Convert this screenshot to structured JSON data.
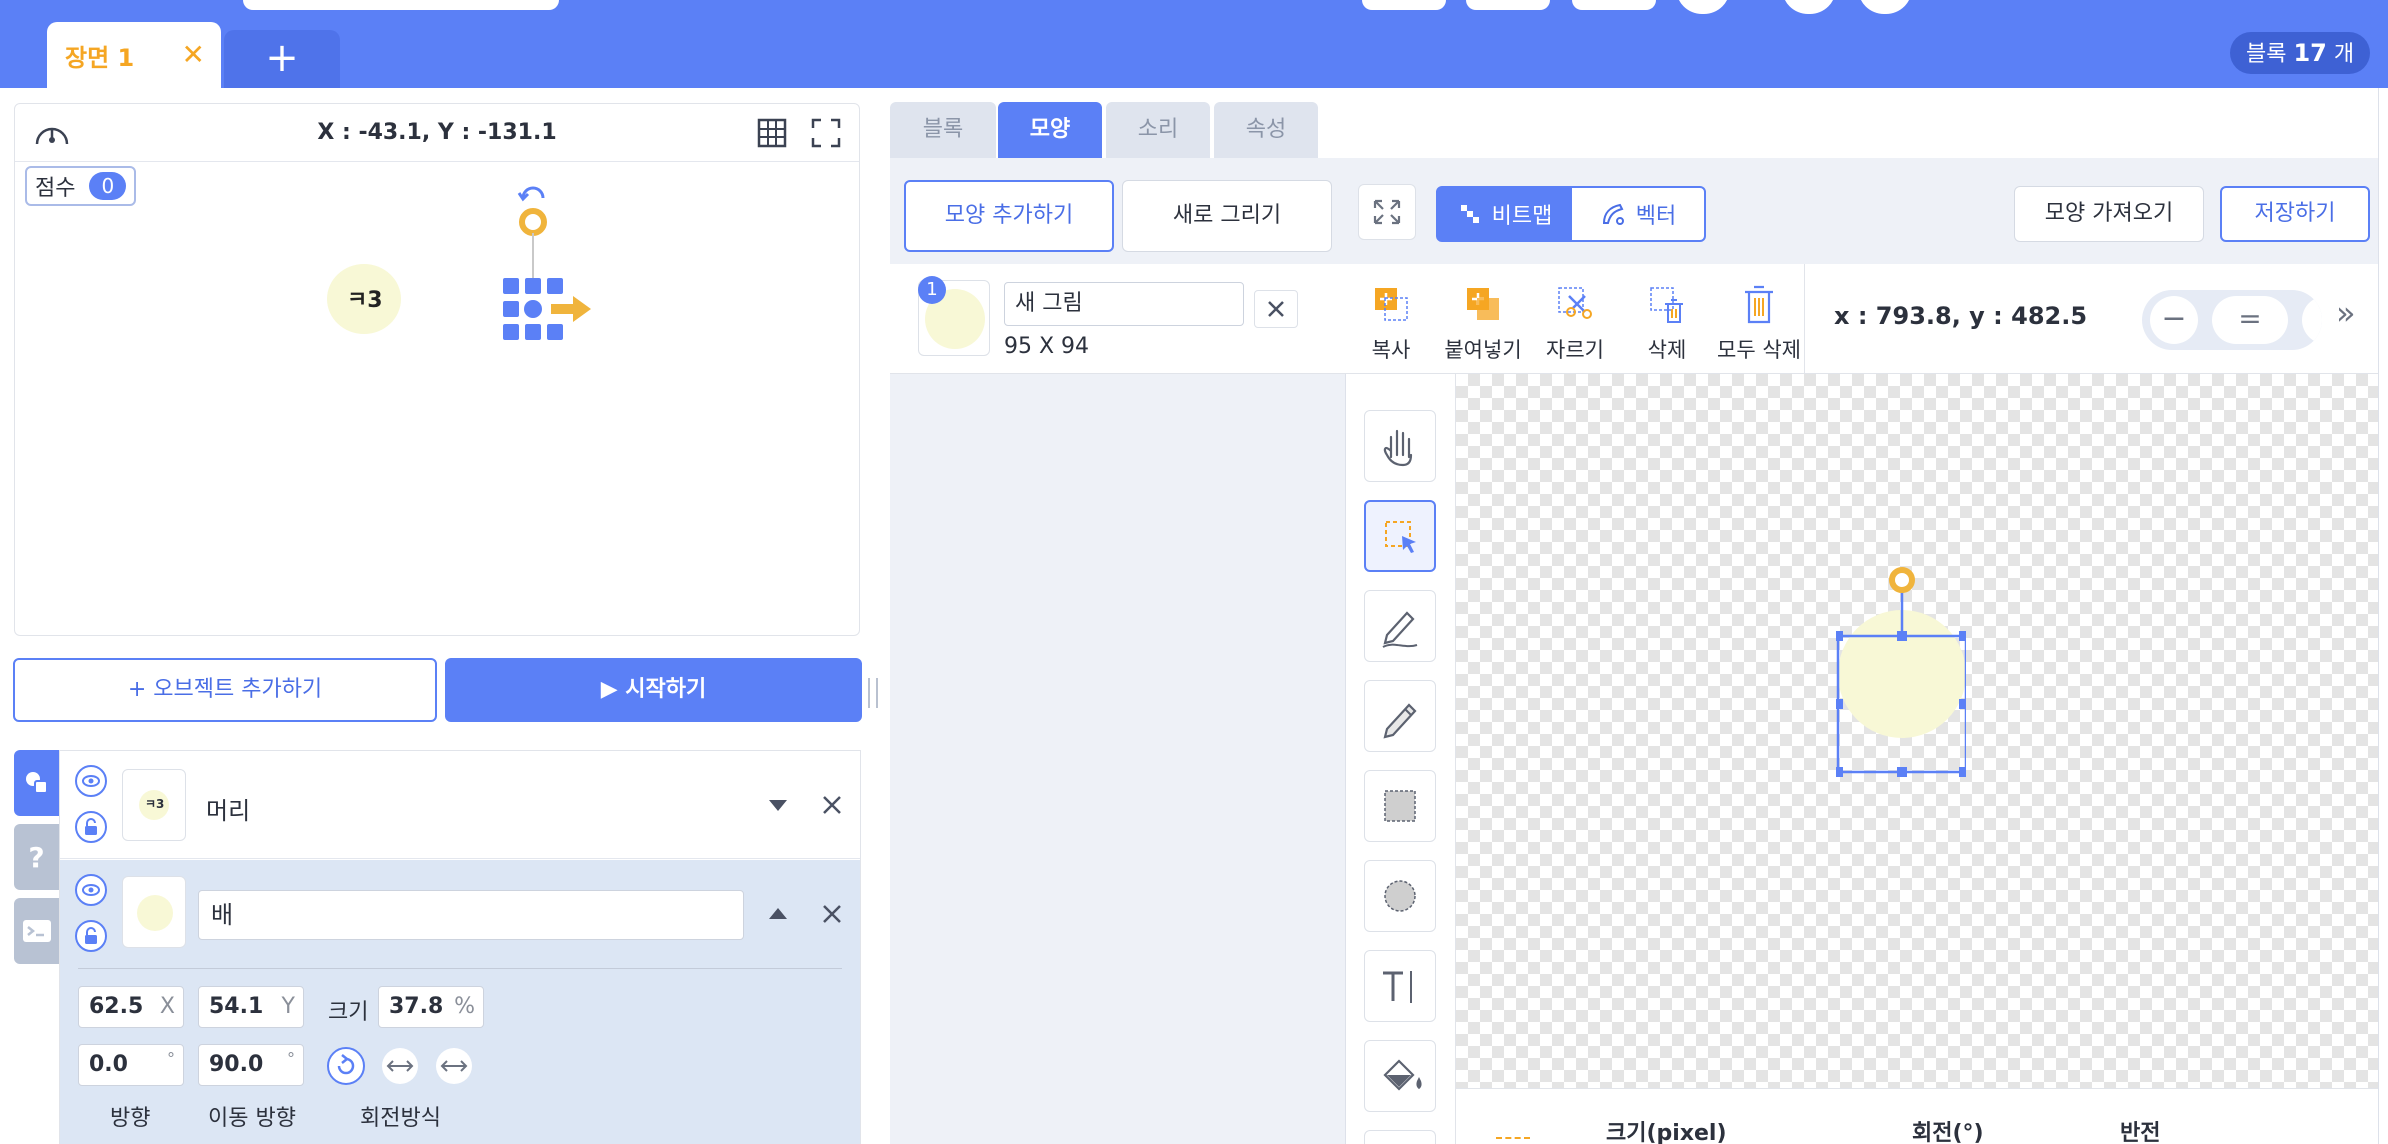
{
  "scene_tab": {
    "label": "장면 1",
    "close_glyph": "✕"
  },
  "add_scene_glyph": "+",
  "block_count": {
    "prefix": "블록",
    "count": "17",
    "suffix": "개"
  },
  "stage": {
    "coordinates": "X : -43.1, Y : -131.1",
    "score_label": "점수",
    "score_value": "0"
  },
  "buttons": {
    "add_object": "+ 오브젝트 추가하기",
    "start": "▶ 시작하기"
  },
  "objects": [
    {
      "name": "머리",
      "thumb_text": "ㅋ3"
    },
    {
      "name": "배"
    }
  ],
  "selected_object": {
    "x": "62.5",
    "x_unit": "X",
    "y": "54.1",
    "y_unit": "Y",
    "size_label": "크기",
    "size": "37.8",
    "size_unit": "%",
    "direction": "0.0",
    "direction_unit": "°",
    "move_direction": "90.0",
    "move_direction_unit": "°",
    "direction_label": "방향",
    "move_direction_label": "이동 방향",
    "rotation_label": "회전방식"
  },
  "tabs": [
    "블록",
    "모양",
    "소리",
    "속성"
  ],
  "shape_panel": {
    "add_shape": "모양 추가하기",
    "new_draw": "새로 그리기",
    "shapes": [
      {
        "index": "1",
        "name": "새 그림",
        "size": "95 X 94"
      }
    ]
  },
  "editor": {
    "mode_bitmap": "비트맵",
    "mode_vector": "벡터",
    "import_shape": "모양 가져오기",
    "save": "저장하기",
    "tools": [
      "복사",
      "붙여넣기",
      "자르기",
      "삭제",
      "모두 삭제"
    ],
    "cursor_coordinates": "x : 793.8, y : 482.5",
    "zoom_minus": "−",
    "zoom_reset": "=",
    "expand_glyph": "»",
    "bottom_labels": [
      "크기(pixel)",
      "회전(°)",
      "반전"
    ]
  },
  "colors": {
    "accent": "#5b80f6",
    "scene_tab_text": "#f5a623",
    "sprite_fill": "#f8f8d6",
    "handle_orange": "#f0b43c"
  }
}
